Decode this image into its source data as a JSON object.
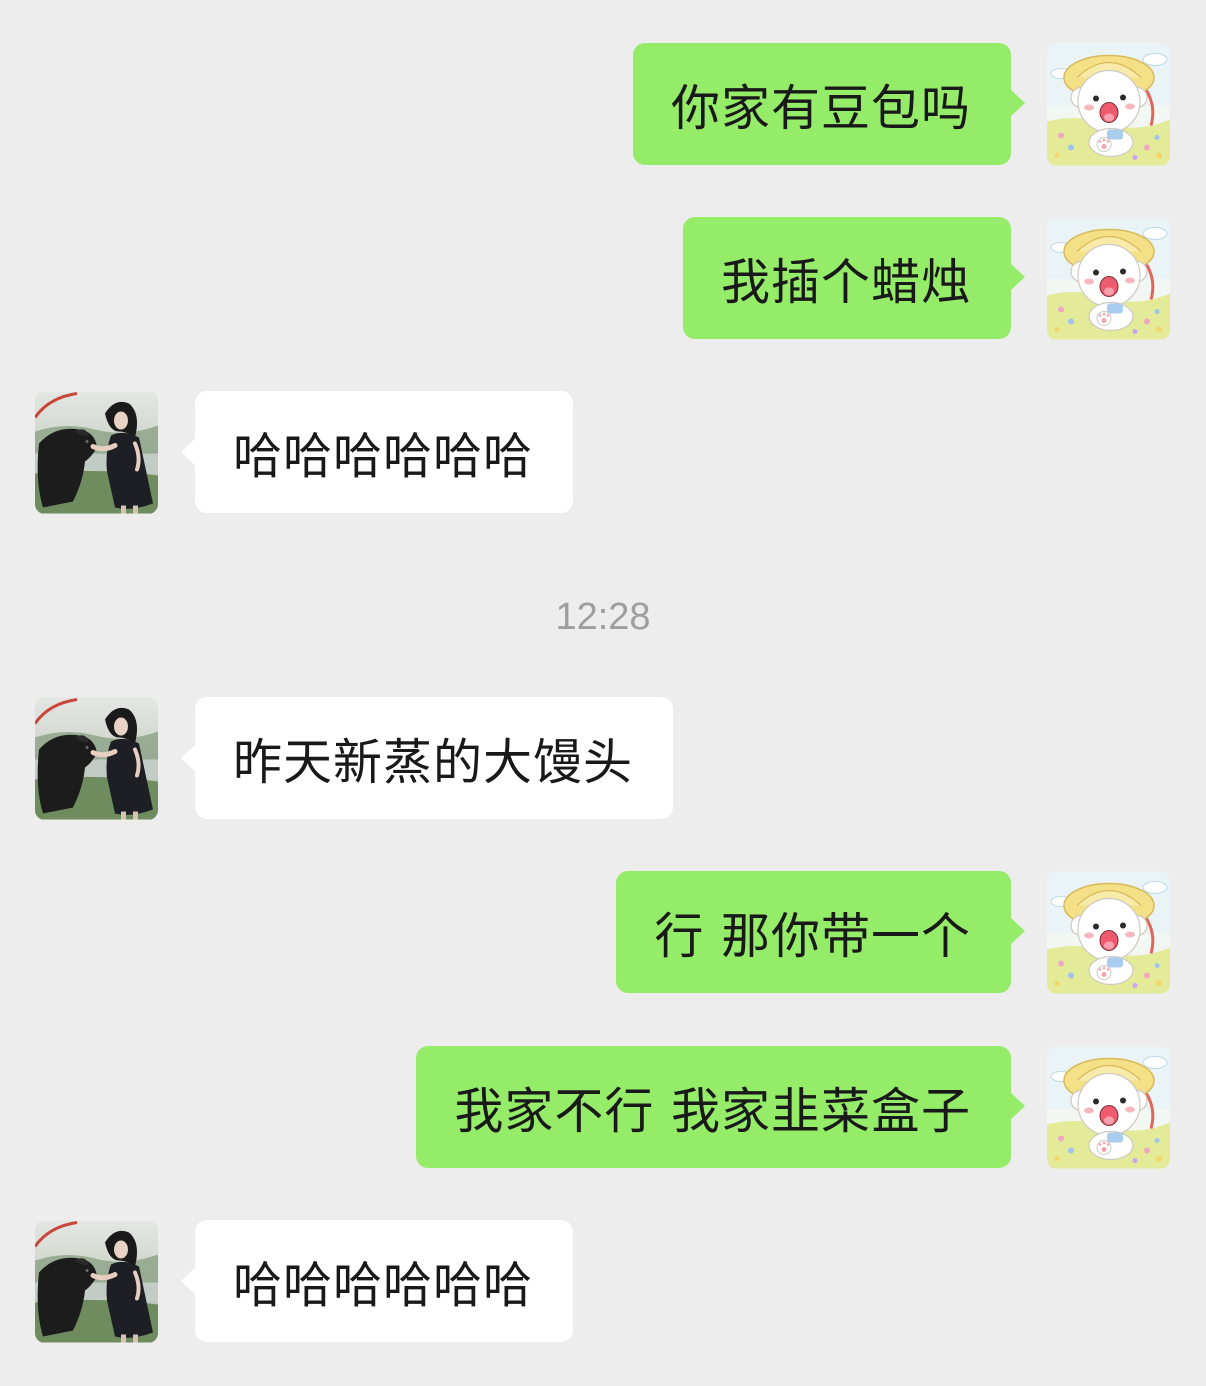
{
  "chat": {
    "messages": [
      {
        "sender": "self",
        "text": "你家有豆包吗"
      },
      {
        "sender": "self",
        "text": "我插个蜡烛"
      },
      {
        "sender": "contact",
        "text": "哈哈哈哈哈哈"
      },
      {
        "sender": "contact",
        "text": "昨天新蒸的大馒头"
      },
      {
        "sender": "self",
        "text": "行 那你带一个"
      },
      {
        "sender": "self",
        "text": "我家不行 我家韭菜盒子"
      },
      {
        "sender": "contact",
        "text": "哈哈哈哈哈哈"
      }
    ],
    "timestamp": "12:28"
  },
  "colors": {
    "background": "#ededed",
    "self_bubble": "#95ec69",
    "contact_bubble": "#ffffff",
    "text": "#191919",
    "timestamp": "#9e9e9e"
  }
}
